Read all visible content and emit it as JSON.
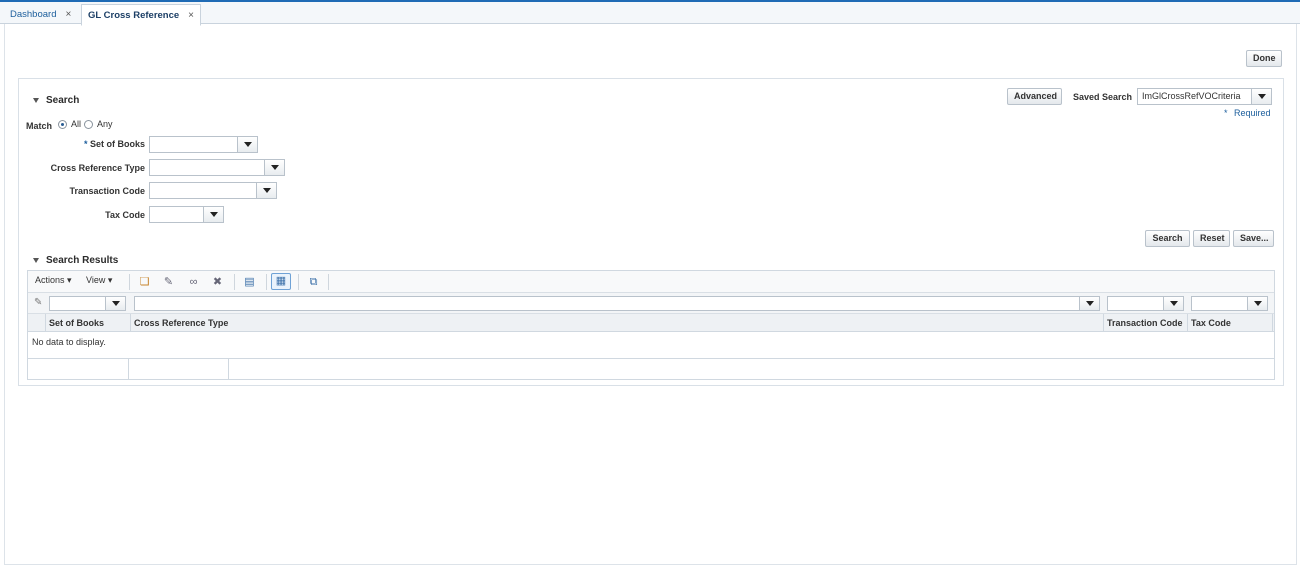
{
  "tabs": [
    {
      "label": "Dashboard",
      "close": "×"
    },
    {
      "label": "GL Cross Reference",
      "close": "×"
    }
  ],
  "done_label": "Done",
  "search": {
    "title": "Search",
    "advanced_label": "Advanced",
    "saved_search_label": "Saved Search",
    "saved_search_value": "ImGlCrossRefVOCriteria",
    "required_note": "Required",
    "required_marker": "*",
    "match_label": "Match",
    "match_all": "All",
    "match_any": "Any",
    "match_selected": "All",
    "fields": [
      {
        "label": "Set of Books",
        "value": "",
        "required": true
      },
      {
        "label": "Cross Reference Type",
        "value": ""
      },
      {
        "label": "Transaction Code",
        "value": ""
      },
      {
        "label": "Tax Code",
        "value": ""
      }
    ],
    "buttons": {
      "search": "Search",
      "reset": "Reset",
      "save": "Save..."
    }
  },
  "results": {
    "title": "Search Results",
    "actions_label": "Actions ▾",
    "view_label": "View ▾",
    "columns": [
      "Set of Books",
      "Cross Reference Type",
      "Transaction Code",
      "Tax Code"
    ],
    "empty_text": "No data to display."
  }
}
